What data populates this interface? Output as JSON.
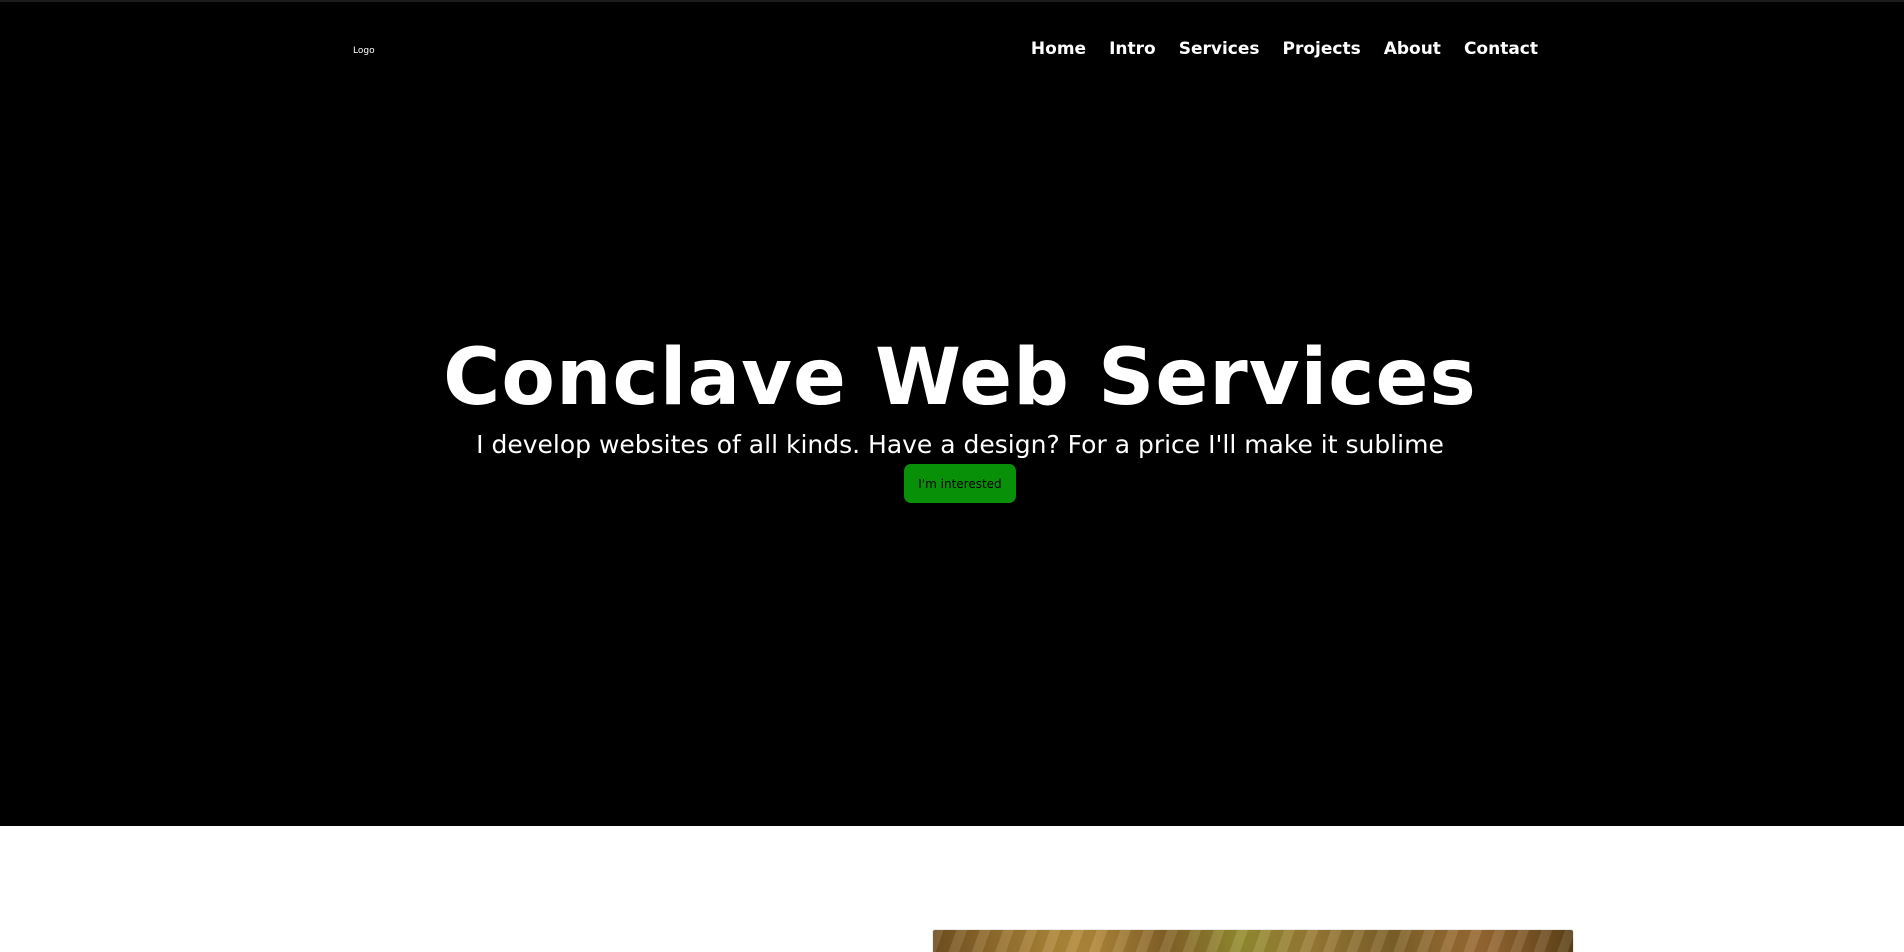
{
  "header": {
    "logo_text": "Logo",
    "nav_items": [
      {
        "label": "Home"
      },
      {
        "label": "Intro"
      },
      {
        "label": "Services"
      },
      {
        "label": "Projects"
      },
      {
        "label": "About"
      },
      {
        "label": "Contact"
      }
    ]
  },
  "hero": {
    "title": "Conclave Web Services",
    "subtitle": "I develop websites of all kinds. Have a design? For a price I'll make it sublime",
    "cta_label": "I'm interested"
  },
  "colors": {
    "hero_background": "#000000",
    "nav_text": "#ffffff",
    "cta_background": "#089008",
    "page_background": "#ffffff"
  },
  "icons": {
    "project_image": "project-image"
  }
}
